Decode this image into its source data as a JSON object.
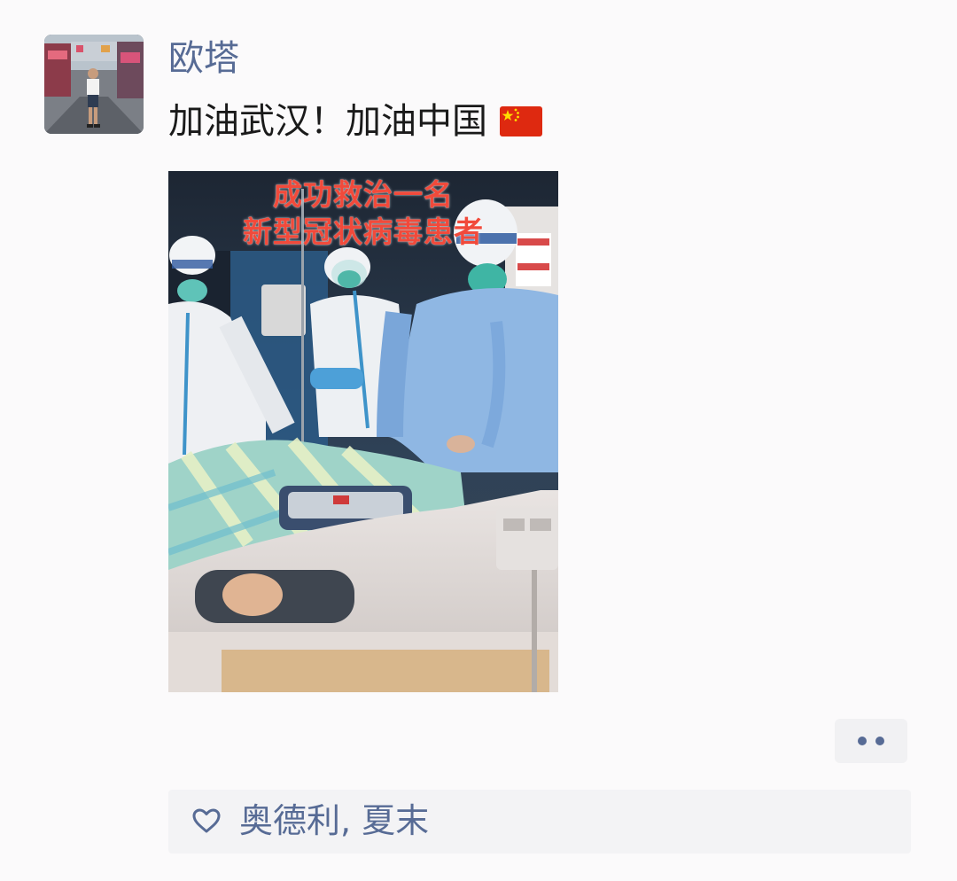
{
  "post": {
    "author": "欧塔",
    "text": "加油武汉！加油中国",
    "flag_icon": "china-flag-icon",
    "image": {
      "caption_line1": "成功救治一名",
      "caption_line2": "新型冠状病毒患者"
    },
    "more_icon": "more-dots-icon",
    "likes": {
      "icon": "heart-outline-icon",
      "names": "奥德利, 夏末"
    }
  },
  "colors": {
    "link_blue": "#576b95",
    "text": "#1a1a1a",
    "background": "#fbfafb",
    "caption_red": "#f14a3b"
  }
}
